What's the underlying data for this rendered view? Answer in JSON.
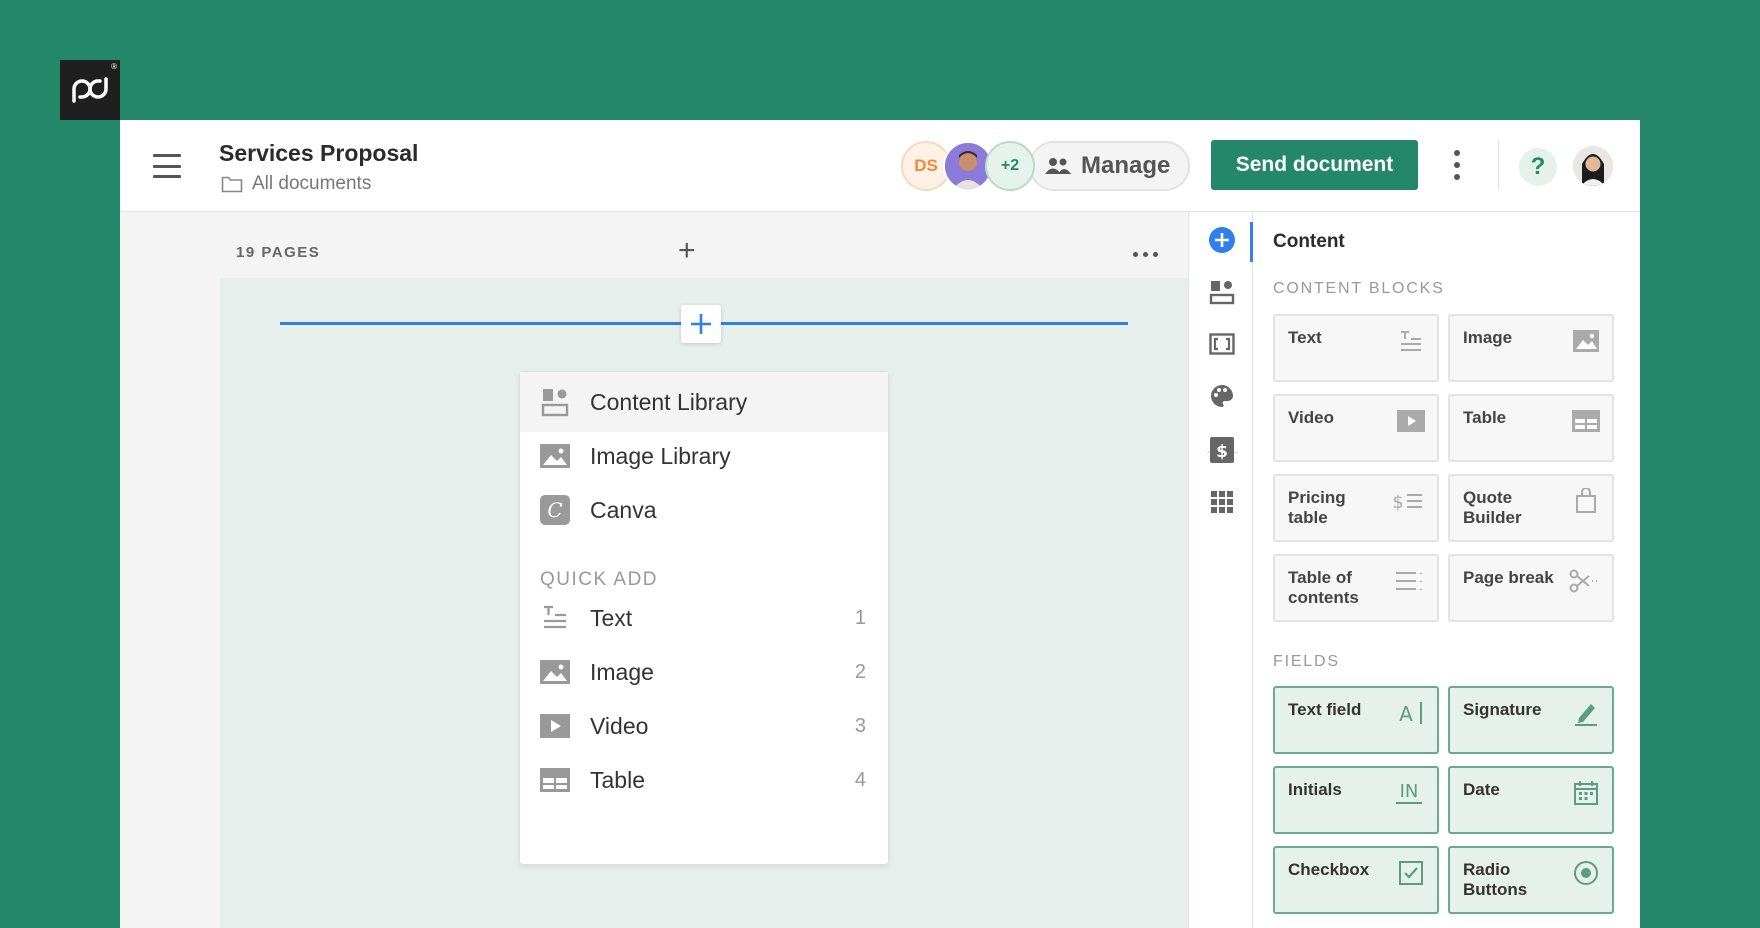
{
  "header": {
    "doc_title": "Services Proposal",
    "breadcrumb": "All documents",
    "avatar_initials": "DS",
    "extra_count": "+2",
    "manage_label": "Manage",
    "send_label": "Send document",
    "help_label": "?"
  },
  "editor": {
    "pages_label": "19 PAGES",
    "add_page": "+"
  },
  "menu": {
    "items": [
      {
        "label": "Content Library",
        "icon": "content-library-icon"
      },
      {
        "label": "Image Library",
        "icon": "image-icon"
      },
      {
        "label": "Canva",
        "icon": "canva-icon"
      }
    ],
    "quick_add_label": "QUICK ADD",
    "quick_add": [
      {
        "label": "Text",
        "key": "1",
        "icon": "text-icon"
      },
      {
        "label": "Image",
        "key": "2",
        "icon": "image-icon"
      },
      {
        "label": "Video",
        "key": "3",
        "icon": "video-icon"
      },
      {
        "label": "Table",
        "key": "4",
        "icon": "table-icon"
      }
    ]
  },
  "panel": {
    "title": "Content",
    "blocks_label": "CONTENT BLOCKS",
    "blocks": [
      {
        "label": "Text",
        "icon": "text-icon"
      },
      {
        "label": "Image",
        "icon": "image-icon"
      },
      {
        "label": "Video",
        "icon": "video-icon"
      },
      {
        "label": "Table",
        "icon": "table-icon"
      },
      {
        "label": "Pricing table",
        "icon": "pricing-table-icon"
      },
      {
        "label": "Quote Builder",
        "icon": "quote-builder-icon"
      },
      {
        "label": "Table of contents",
        "icon": "table-of-contents-icon"
      },
      {
        "label": "Page break",
        "icon": "scissors-icon"
      }
    ],
    "fields_label": "FIELDS",
    "fields": [
      {
        "label": "Text field",
        "icon": "text-field-icon"
      },
      {
        "label": "Signature",
        "icon": "signature-icon"
      },
      {
        "label": "Initials",
        "icon": "initials-icon"
      },
      {
        "label": "Date",
        "icon": "calendar-icon"
      },
      {
        "label": "Checkbox",
        "icon": "checkbox-icon"
      },
      {
        "label": "Radio Buttons",
        "icon": "radio-icon"
      }
    ]
  },
  "colors": {
    "brand": "#24876a",
    "accent": "#2f80ed",
    "background": "#24876a"
  }
}
